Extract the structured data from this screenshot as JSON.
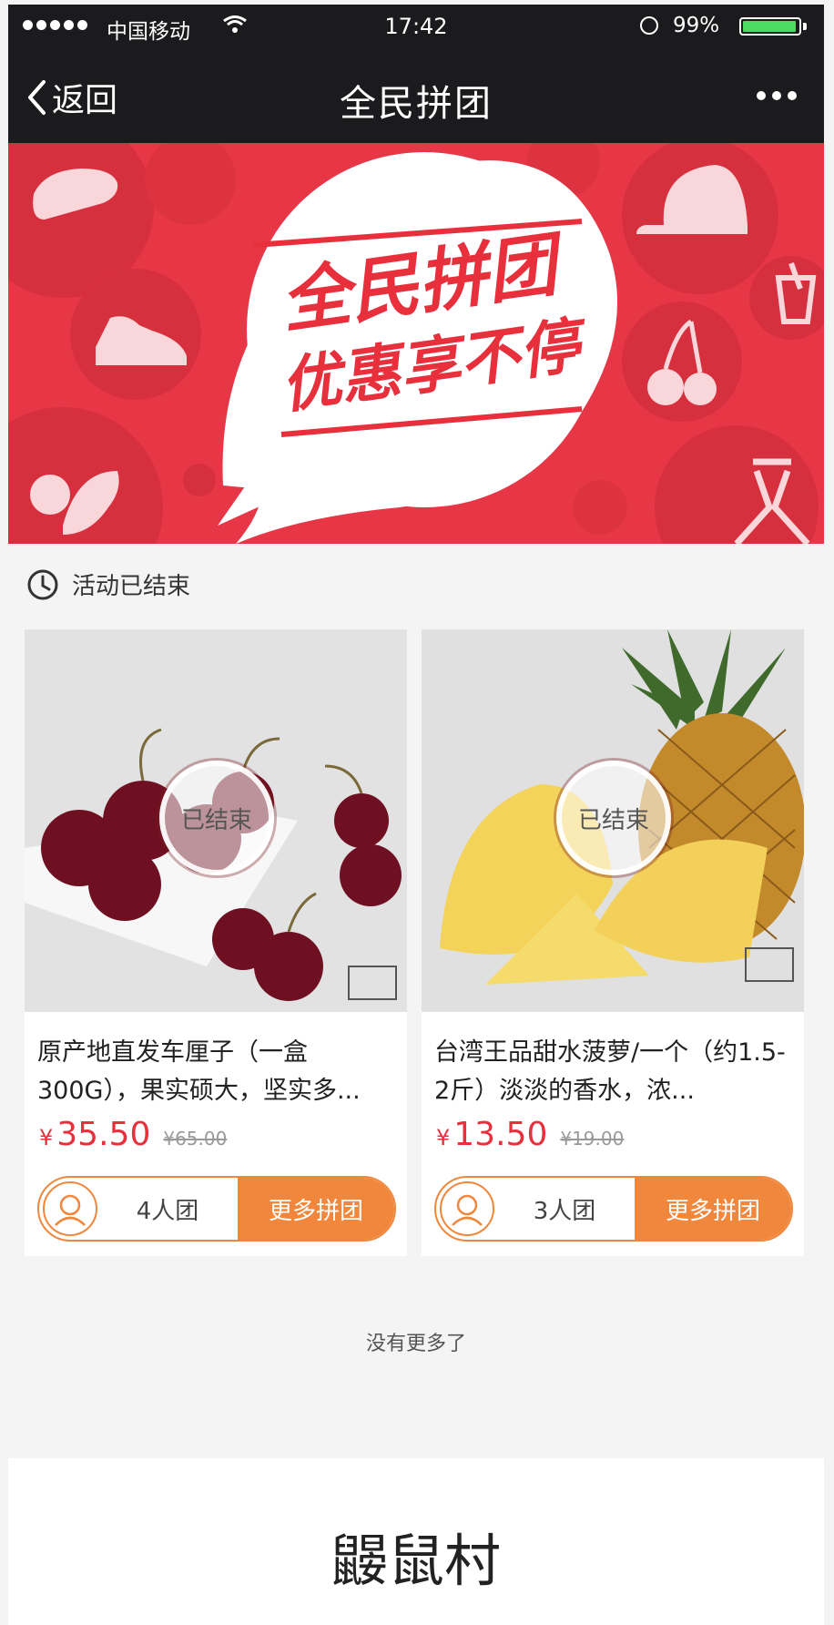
{
  "status_bar": {
    "carrier": "中国移动",
    "time": "17:42",
    "battery": "99%",
    "battery_level": 0.99
  },
  "nav": {
    "back_label": "返回",
    "title": "全民拼团"
  },
  "banner": {
    "line1": "全民拼团",
    "line2": "优惠享不停"
  },
  "activity": {
    "status": "活动已结束"
  },
  "products": [
    {
      "title": "原产地直发车厘子（一盒300G），果实硕大，坚实多...",
      "currency": "¥",
      "price": "35.50",
      "original_price": "¥65.00",
      "status_badge": "已结束",
      "group_size": "4人团",
      "action": "更多拼团"
    },
    {
      "title": "台湾王品甜水菠萝/一个（约1.5-2斤）淡淡的香水，浓...",
      "currency": "¥",
      "price": "13.50",
      "original_price": "¥19.00",
      "status_badge": "已结束",
      "group_size": "3人团",
      "action": "更多拼团"
    }
  ],
  "list_end": "没有更多了",
  "footer": {
    "brand": "鼹鼠村"
  },
  "colors": {
    "primary_red": "#e8303d",
    "accent_orange": "#f0873c",
    "banner_red": "#e73645",
    "bar_dark": "#1b1b1e"
  }
}
